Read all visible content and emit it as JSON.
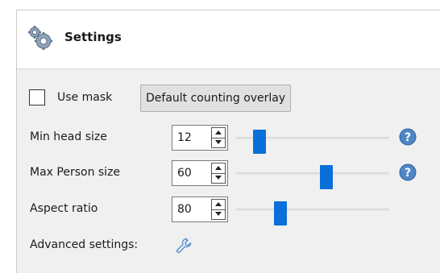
{
  "header": {
    "title": "Settings",
    "icon": "gears-icon"
  },
  "mask": {
    "label": "Use mask",
    "checked": false,
    "overlay_button": "Default counting overlay"
  },
  "rows": [
    {
      "label": "Min head size",
      "value": "12",
      "slider_fraction": 0.15,
      "help": true
    },
    {
      "label": "Max Person size",
      "value": "60",
      "slider_fraction": 0.59,
      "help": true
    },
    {
      "label": "Aspect ratio",
      "value": "80",
      "slider_fraction": 0.29,
      "help": false
    }
  ],
  "advanced": {
    "label": "Advanced settings:",
    "icon": "wrench-icon"
  },
  "colors": {
    "slider_thumb": "#0a6fd8",
    "help_icon": "#4f86c6",
    "panel_bg": "#f0f0f0"
  }
}
